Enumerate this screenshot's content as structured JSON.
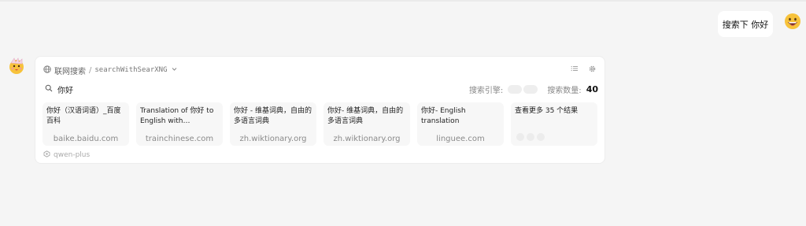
{
  "user_message": {
    "text": "搜索下 你好"
  },
  "assistant": {
    "plugin": {
      "name": "联网搜索",
      "separator": "/",
      "identifier": "searchWithSearXNG"
    },
    "query": "你好",
    "engines_label": "搜索引擎:",
    "results_count_label": "搜索数量:",
    "results_count": "40",
    "results": [
      {
        "title": "你好（汉语词语）_百度百科",
        "site": "baike.baidu.com"
      },
      {
        "title": "Translation of 你好 to English with examples o...",
        "site": "trainchinese.com"
      },
      {
        "title": "你好 - 维基词典，自由的多语言词典",
        "site": "zh.wiktionary.org"
      },
      {
        "title": "你好- 维基词典，自由的多语言词典",
        "site": "zh.wiktionary.org"
      },
      {
        "title": "你好- English translation",
        "site": "linguee.com"
      }
    ],
    "more_results": "查看更多 35 个结果",
    "model": "qwen-plus"
  },
  "icons": {
    "user_avatar": "grinning-face-icon",
    "bot_avatar": "party-face-icon",
    "globe": "globe-icon",
    "chevron": "chevron-down-icon",
    "list": "list-icon",
    "settings": "gear-icon",
    "search": "search-icon",
    "model": "model-icon"
  }
}
